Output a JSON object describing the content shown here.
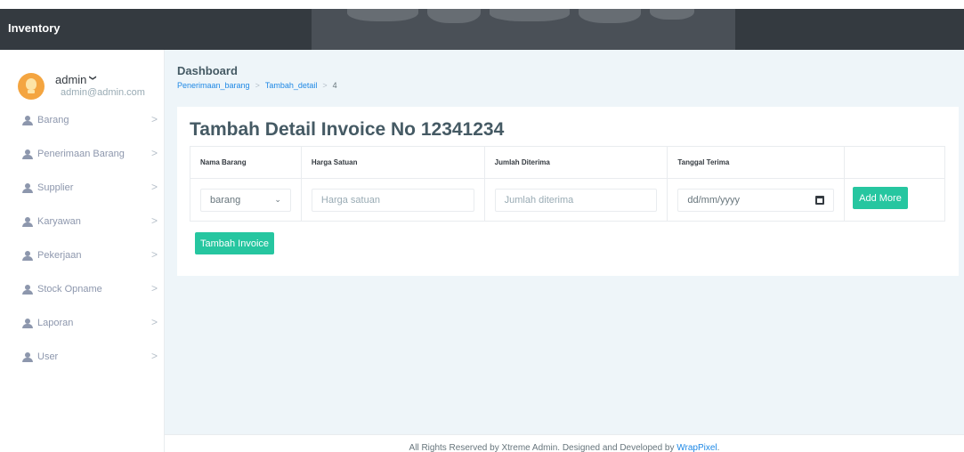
{
  "app": {
    "brand": "Inventory"
  },
  "profile": {
    "name": "admin",
    "chevron": "❯",
    "email": "admin@admin.com",
    "avatar_icon": "lightbulb-avatar"
  },
  "sidebar": {
    "items": [
      {
        "label": "Barang",
        "icon": "user-icon"
      },
      {
        "label": "Penerimaan Barang",
        "icon": "user-icon"
      },
      {
        "label": "Supplier",
        "icon": "user-icon"
      },
      {
        "label": "Karyawan",
        "icon": "user-icon"
      },
      {
        "label": "Pekerjaan",
        "icon": "user-icon"
      },
      {
        "label": "Stock Opname",
        "icon": "user-icon"
      },
      {
        "label": "Laporan",
        "icon": "user-icon"
      },
      {
        "label": "User",
        "icon": "user-icon"
      }
    ],
    "arrow": ">"
  },
  "header": {
    "title": "Dashboard",
    "breadcrumbs": [
      "Penerimaan_barang",
      "Tambah_detail",
      "4"
    ],
    "separator": ">"
  },
  "card": {
    "title": "Tambah Detail Invoice No 12341234",
    "columns": [
      "Nama Barang",
      "Harga Satuan",
      "Jumlah Diterima",
      "Tanggal Terima"
    ],
    "row": {
      "nama_barang_value": "barang",
      "harga_placeholder": "Harga satuan",
      "jumlah_placeholder": "Jumlah diterima",
      "tanggal_placeholder": "dd/mm/yyyy"
    },
    "add_more_label": "Add More",
    "submit_label": "Tambah Invoice"
  },
  "footer": {
    "text": "All Rights Reserved by Xtreme Admin. Designed and Developed by ",
    "link": "WrapPixel",
    "end": "."
  },
  "colors": {
    "accent": "#26c6a0",
    "link": "#1e88e5",
    "topbar": "#343a40"
  }
}
